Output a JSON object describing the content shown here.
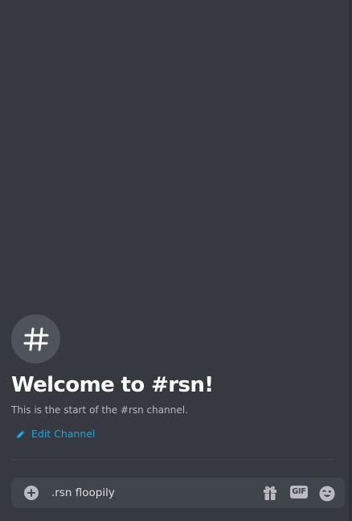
{
  "channel": {
    "icon": "hash-icon",
    "welcome_title": "Welcome to #rsn!",
    "welcome_subtitle": "This is the start of the #rsn channel.",
    "edit_label": "Edit Channel"
  },
  "composer": {
    "message_value": ".rsn floopily",
    "attach_icon": "plus-circle-icon",
    "gift_icon": "gift-icon",
    "gif_label": "GIF",
    "emoji_icon": "emoji-icon"
  },
  "colors": {
    "background": "#36393f",
    "composer_background": "#40444b",
    "accent_link": "#00aff4",
    "title": "#ffffff",
    "muted_text": "#b9bbbe"
  }
}
